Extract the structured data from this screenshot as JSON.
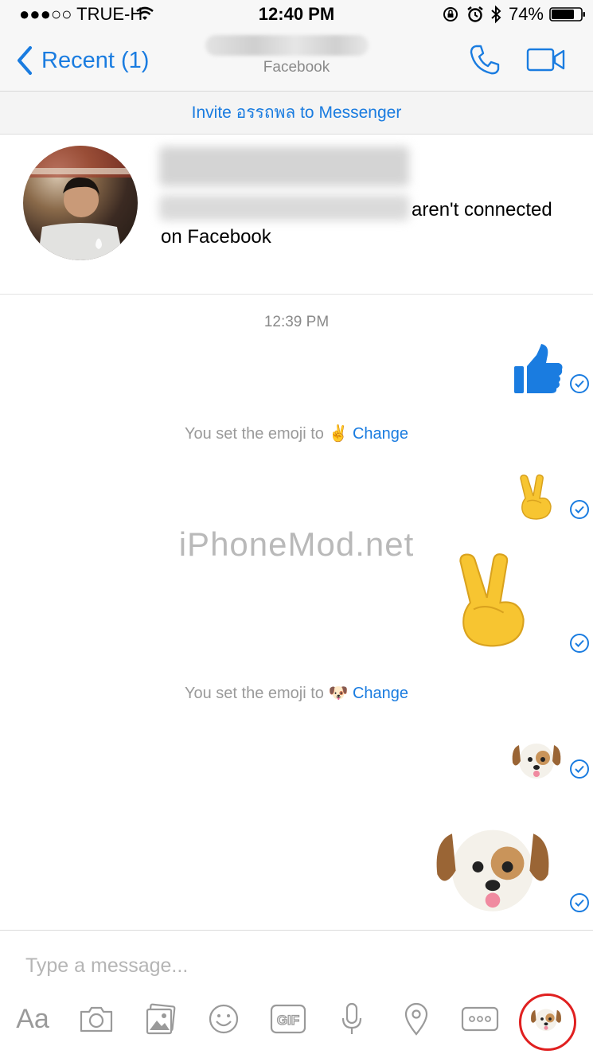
{
  "status_bar": {
    "carrier": "●●●○○ TRUE-H",
    "time": "12:40 PM",
    "battery": "74%"
  },
  "nav": {
    "back_label": "Recent (1)",
    "subtitle": "Facebook"
  },
  "invite": {
    "label": "Invite อรรถพล to Messenger"
  },
  "profile": {
    "connection_line1": "aren't connected",
    "connection_line2": "on Facebook"
  },
  "thread": {
    "timestamp": "12:39 PM",
    "system_messages": [
      {
        "text": "You set the emoji to",
        "emoji": "✌️",
        "action": "Change"
      },
      {
        "text": "You set the emoji to",
        "emoji": "🐶",
        "action": "Change"
      }
    ],
    "watermark": "iPhoneMod.net"
  },
  "composer": {
    "placeholder": "Type a message...",
    "text_tool_label": "Aa",
    "gif_label": "GIF"
  },
  "colors": {
    "accent": "#1a7ce0",
    "highlight_circle": "#e02020"
  },
  "icons": [
    "wifi-icon",
    "battery-icon",
    "bluetooth-icon",
    "alarm-icon",
    "rotation-lock-icon",
    "back-chevron-icon",
    "phone-icon",
    "video-icon",
    "thumbs-up-icon",
    "check-icon",
    "camera-icon",
    "photos-icon",
    "smiley-icon",
    "gif-icon",
    "mic-icon",
    "location-icon",
    "more-icon",
    "dog-emoji-button"
  ]
}
